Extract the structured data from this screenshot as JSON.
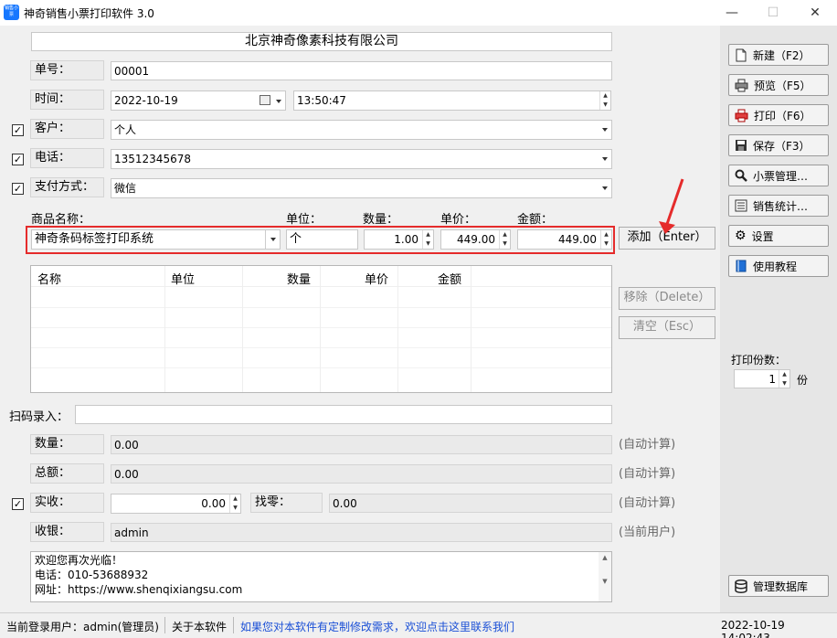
{
  "window": {
    "title": "神奇销售小票打印软件 3.0",
    "icon_text": "销售小票",
    "minimize": "—",
    "maximize": "☐",
    "close": "✕"
  },
  "form": {
    "company": "北京神奇像素科技有限公司",
    "order_no_label": "单号：",
    "order_no": "00001",
    "time_label": "时间：",
    "date": "2022-10-19",
    "time": "13:50:47",
    "customer_label": "客户：",
    "customer": "个人",
    "phone_label": "电话：",
    "phone": "13512345678",
    "payment_label": "支付方式：",
    "payment": "微信",
    "check_mark": "✓"
  },
  "item_entry": {
    "name_label": "商品名称：",
    "unit_label": "单位：",
    "qty_label": "数量：",
    "price_label": "单价：",
    "amount_label": "金额：",
    "name": "神奇条码标签打印系统",
    "unit": "个",
    "qty": "1.00",
    "price": "449.00",
    "amount": "449.00",
    "add_button": "添加（Enter）"
  },
  "table": {
    "columns": [
      "名称",
      "单位",
      "数量",
      "单价",
      "金额"
    ],
    "rows": []
  },
  "table_buttons": {
    "remove": "移除（Delete）",
    "clear": "清空（Esc）"
  },
  "scan": {
    "label": "扫码录入：",
    "value": ""
  },
  "summary": {
    "qty_label": "数量：",
    "qty_value": "0.00",
    "total_label": "总额：",
    "total_value": "0.00",
    "received_label": "实收：",
    "received_value": "0.00",
    "change_label": "找零：",
    "change_value": "0.00",
    "cashier_label": "收银：",
    "cashier_value": "admin",
    "auto_calc": "(自动计算)",
    "current_user": "(当前用户)"
  },
  "footer_note": {
    "line1": "欢迎您再次光临！",
    "line2": "电话：010-53688932",
    "line3": "网址：https://www.shenqixiangsu.com"
  },
  "sidebar": {
    "new": "新建（F2）",
    "preview": "预览（F5）",
    "print": "打印（F6）",
    "save": "保存（F3）",
    "receipt_mgmt": "小票管理…",
    "sales_stats": "销售统计…",
    "settings": "设置",
    "tutorial": "使用教程",
    "copies_label": "打印份数：",
    "copies_value": "1",
    "copies_unit": "份",
    "db_mgmt": "管理数据库"
  },
  "status": {
    "login_user": "当前登录用户：admin(管理员)",
    "about": "关于本软件",
    "custom_link": "如果您对本软件有定制修改需求，欢迎点击这里联系我们",
    "datetime": "2022-10-19 14:02:43"
  },
  "colors": {
    "highlight_border": "#e52b2b",
    "link": "#1a4fd6",
    "arrow": "#e52b2b"
  }
}
